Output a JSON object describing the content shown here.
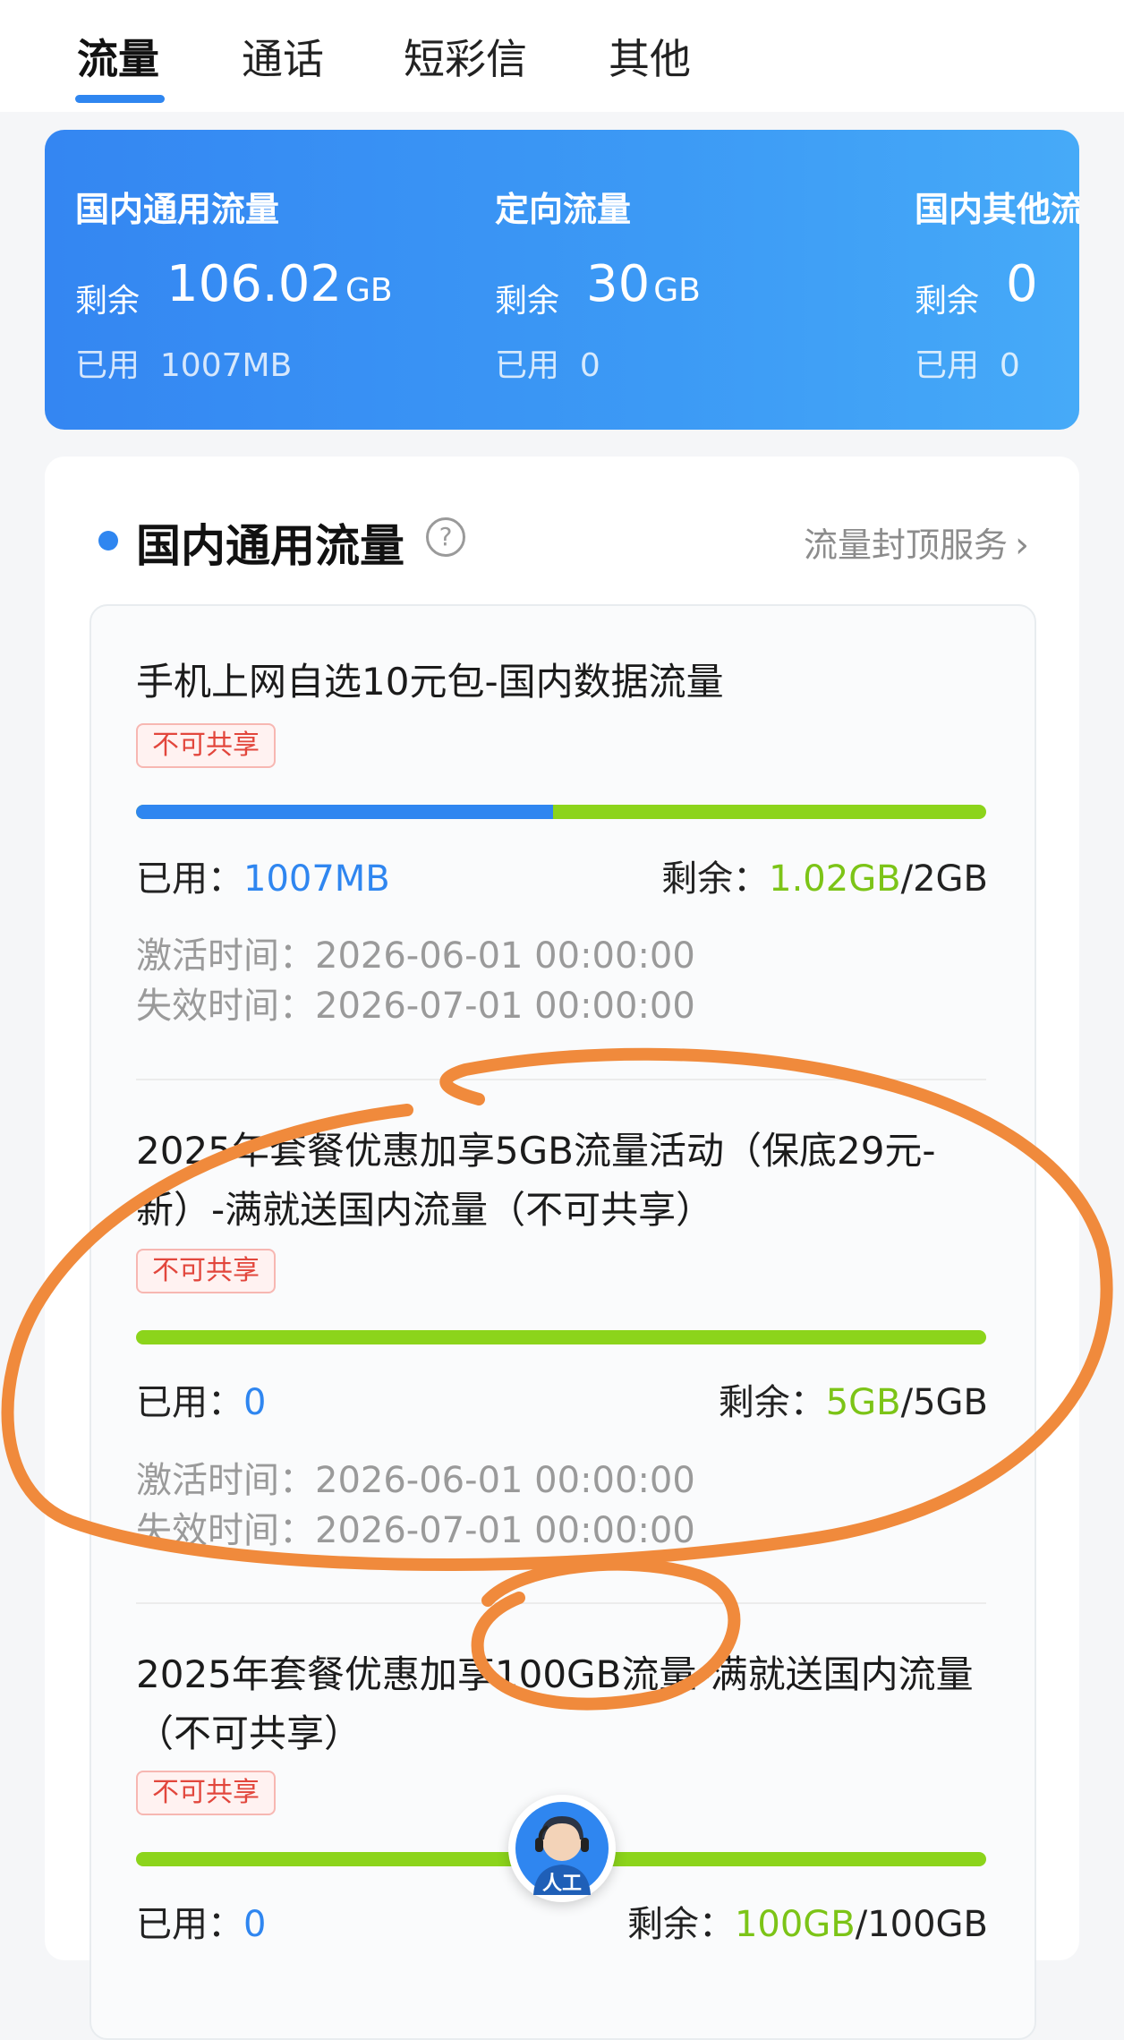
{
  "tabs": [
    {
      "label": "流量",
      "active": true
    },
    {
      "label": "通话",
      "active": false
    },
    {
      "label": "短彩信",
      "active": false
    },
    {
      "label": "其他",
      "active": false
    }
  ],
  "summary": [
    {
      "title": "国内通用流量",
      "remain_label": "剩余",
      "remain_value": "106.02",
      "remain_unit": "GB",
      "used_label": "已用",
      "used_value": "1007MB"
    },
    {
      "title": "定向流量",
      "remain_label": "剩余",
      "remain_value": "30",
      "remain_unit": "GB",
      "used_label": "已用",
      "used_value": "0"
    },
    {
      "title": "国内其他流",
      "remain_label": "剩余",
      "remain_value": "0",
      "remain_unit": "",
      "used_label": "已用",
      "used_value": "0"
    }
  ],
  "section": {
    "title": "国内通用流量",
    "help_icon": "question-circle-icon",
    "cap_link": "流量封顶服务",
    "cap_chevron": "›"
  },
  "packages": [
    {
      "title": "手机上网自选10元包-国内数据流量",
      "tag": "不可共享",
      "used_fraction": 0.49,
      "used_label": "已用：",
      "used_value": "1007MB",
      "remain_label": "剩余：",
      "remain_value": "1.02GB",
      "total": "/2GB",
      "activate_label": "激活时间：",
      "activate_time": "2026-06-01 00:00:00",
      "expire_label": "失效时间：",
      "expire_time": "2026-07-01 00:00:00"
    },
    {
      "title": "2025年套餐优惠加享5GB流量活动（保底29元-新）-满就送国内流量（不可共享）",
      "tag": "不可共享",
      "used_fraction": 0,
      "used_label": "已用：",
      "used_value": "0",
      "remain_label": "剩余：",
      "remain_value": "5GB",
      "total": "/5GB",
      "activate_label": "激活时间：",
      "activate_time": "2026-06-01 00:00:00",
      "expire_label": "失效时间：",
      "expire_time": "2026-07-01 00:00:00"
    },
    {
      "title": "2025年套餐优惠加享100GB流量-满就送国内流量（不可共享）",
      "tag": "不可共享",
      "used_fraction": 0,
      "used_label": "已用：",
      "used_value": "0",
      "remain_label": "剩余：",
      "remain_value": "100GB",
      "total": "/100GB"
    }
  ],
  "agent_button": {
    "label": "人工",
    "icon": "customer-service-agent-icon"
  },
  "colors": {
    "accent_blue": "#2f86f0",
    "remain_green": "#7cc417",
    "bar_green": "#8cd41b",
    "tag_red": "#e2463c",
    "annotation_orange": "#f08a3c"
  }
}
